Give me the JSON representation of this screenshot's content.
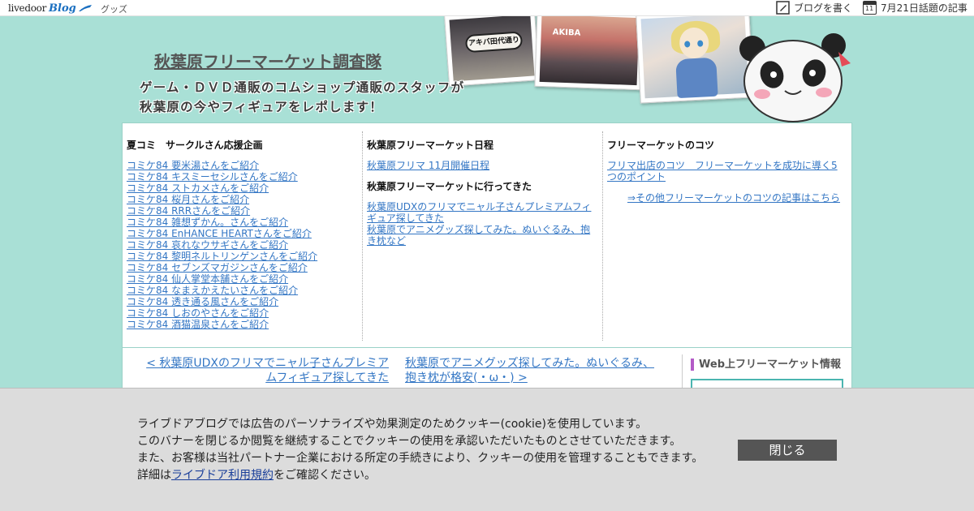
{
  "topbar": {
    "logo_text": "livedoor",
    "logo_blog": "Blog",
    "goods": "グッズ",
    "write_blog": "ブログを書く",
    "calendar_day": "11",
    "today_topics": "7月21日話題の記事"
  },
  "header": {
    "site_title": "秋葉原フリーマーケット調査隊",
    "tagline_line1": "ゲーム・ＤＶＤ通販のコムショップ通販のスタッフが",
    "tagline_line2": "秋葉原の今やフィギュアをレポします！",
    "photo_sign": "アキバ田代通り",
    "photo_store": "AKIBA"
  },
  "nav": {
    "col1": {
      "heading": "夏コミ　サークルさん応援企画",
      "links": [
        "コミケ84 要米湯さんをご紹介",
        "コミケ84 キスミーセシルさんをご紹介",
        "コミケ84 ストカメさんをご紹介",
        "コミケ84 桜月さんをご紹介",
        "コミケ84 RRRさんをご紹介",
        "コミケ84 雑想ずかん。さんをご紹介",
        "コミケ84 EnHANCE HEARTさんをご紹介",
        "コミケ84 哀れなウサギさんをご紹介",
        "コミケ84 黎明ネルトリンゲンさんをご紹介",
        "コミケ84 セブンズマガジンさんをご紹介",
        "コミケ84 仙人掌堂本舗さんをご紹介",
        "コミケ84 なまえかえたいさんをご紹介",
        "コミケ84 透き通る風さんをご紹介",
        "コミケ84 しおのやさんをご紹介",
        "コミケ84 酒猫温泉さんをご紹介"
      ]
    },
    "col2": {
      "heading1": "秋葉原フリーマーケット日程",
      "link1": "秋葉原フリマ 11月開催日程",
      "heading2": "秋葉原フリーマーケットに行ってきた",
      "link2": "秋葉原UDXのフリマでニャル子さんプレミアムフィギュア探してきた",
      "link3": "秋葉原でアニメグッズ探してみた。ぬいぐるみ、抱き枕など"
    },
    "col3": {
      "heading": "フリーマーケットのコツ",
      "link1": "フリマ出店のコツ　フリーマーケットを成功に導く5つのポイント",
      "more": "⇒その他フリーマーケットのコツの記事はこちら"
    }
  },
  "article_nav": {
    "prev": "< 秋葉原UDXのフリマでニャル子さんプレミアムフィギュア探してきた",
    "next": "秋葉原でアニメグッズ探してみた。ぬいぐるみ、抱き枕が格安(・ω・) >"
  },
  "sidebar": {
    "title": "Web上フリーマーケット情報"
  },
  "cookie": {
    "line1": "ライブドアブログでは広告のパーソナライズや効果測定のためクッキー(cookie)を使用しています。",
    "line2": "このバナーを閉じるか閲覧を継続することでクッキーの使用を承認いただいたものとさせていただきます。",
    "line3": "また、お客様は当社パートナー企業における所定の手続きにより、クッキーの使用を管理することもできます。",
    "line4_prefix": "詳細は",
    "line4_link": "ライブドア利用規約",
    "line4_suffix": "をご確認ください。",
    "close_label": "閉じる"
  },
  "colors": {
    "page_bg": "#a9e0d6",
    "link": "#3376c4",
    "banner_bg": "#dcdcdc",
    "button_bg": "#555555",
    "sidebar_accent": "#b35bc7"
  }
}
